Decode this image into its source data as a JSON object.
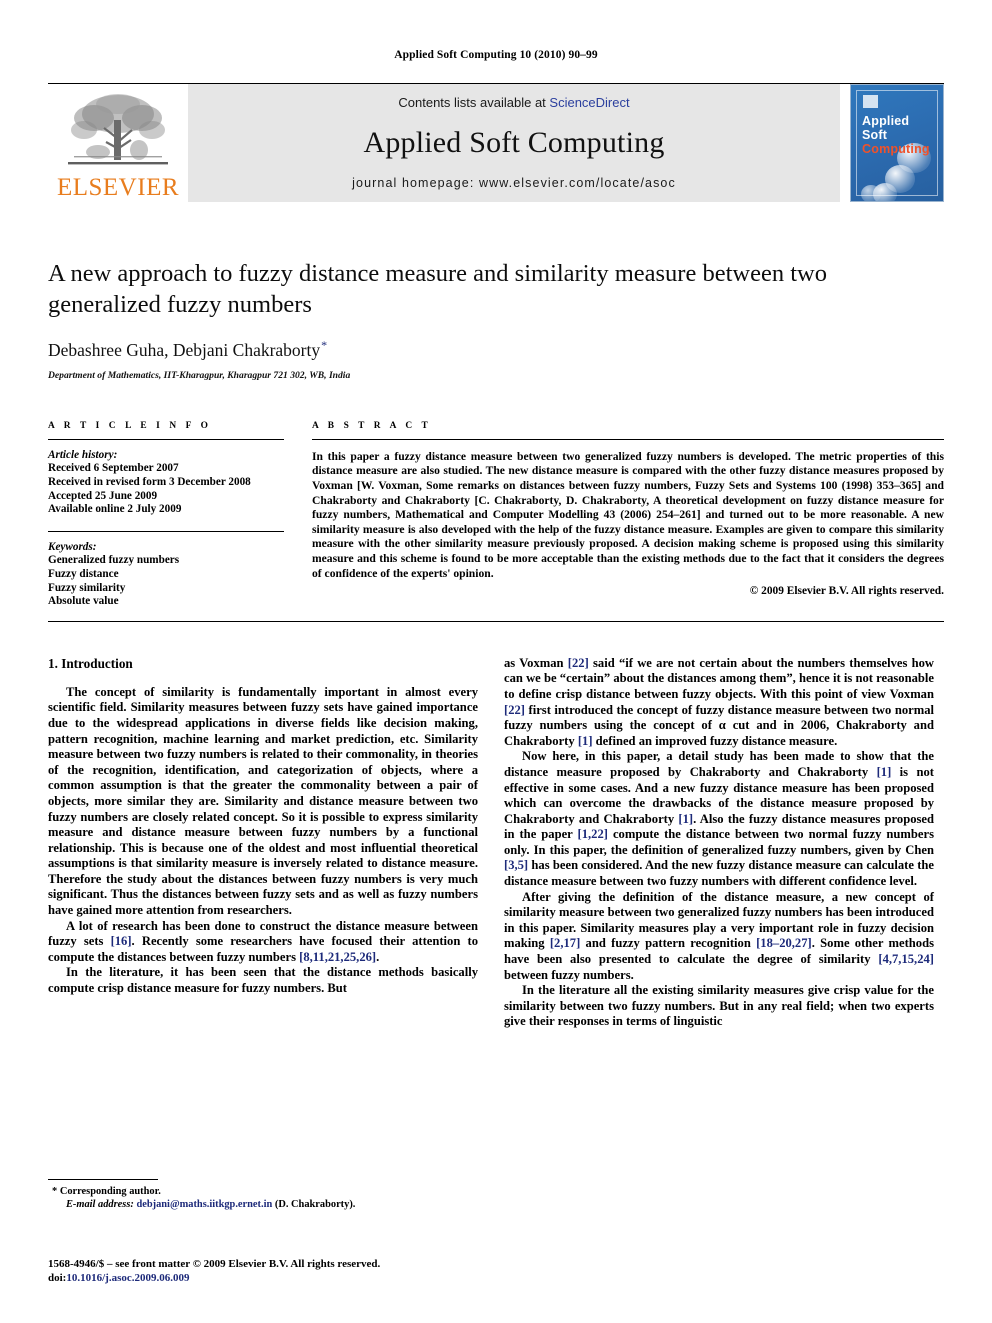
{
  "running_head": "Applied Soft Computing 10 (2010) 90–99",
  "masthead": {
    "publisher_wordmark": "ELSEVIER",
    "contents_prefix": "Contents lists available at ",
    "contents_link": "ScienceDirect",
    "journal_name": "Applied Soft Computing",
    "homepage": "journal homepage: www.elsevier.com/locate/asoc",
    "cover": {
      "line1": "Applied",
      "line2": "Soft",
      "line3": "Computing",
      "accent_color": "#f0522a",
      "background_color": "#2d6fb4"
    }
  },
  "article": {
    "title": "A new approach to fuzzy distance measure and similarity measure between two generalized fuzzy numbers",
    "authors": "Debashree Guha, Debjani Chakraborty",
    "corresponding_marker": "*",
    "affiliation": "Department of Mathematics, IIT-Kharagpur, Kharagpur 721 302, WB, India"
  },
  "article_info": {
    "heading": "A R T I C L E   I N F O",
    "history_label": "Article history:",
    "history": [
      "Received 6 September 2007",
      "Received in revised form 3 December 2008",
      "Accepted 25 June 2009",
      "Available online 2 July 2009"
    ],
    "keywords_label": "Keywords:",
    "keywords": [
      "Generalized fuzzy numbers",
      "Fuzzy distance",
      "Fuzzy similarity",
      "Absolute value"
    ]
  },
  "abstract": {
    "heading": "A B S T R A C T",
    "text": "In this paper a fuzzy distance measure between two generalized fuzzy numbers is developed. The metric properties of this distance measure are also studied. The new distance measure is compared with the other fuzzy distance measures proposed by Voxman [W. Voxman, Some remarks on distances between fuzzy numbers, Fuzzy Sets and Systems 100 (1998) 353–365] and Chakraborty and Chakraborty [C. Chakraborty, D. Chakraborty, A theoretical development on fuzzy distance measure for fuzzy numbers, Mathematical and Computer Modelling 43 (2006) 254–261] and turned out to be more reasonable. A new similarity measure is also developed with the help of the fuzzy distance measure. Examples are given to compare this similarity measure with the other similarity measure previously proposed. A decision making scheme is proposed using this similarity measure and this scheme is found to be more acceptable than the existing methods due to the fact that it considers the degrees of confidence of the experts' opinion.",
    "copyright": "© 2009 Elsevier B.V. All rights reserved."
  },
  "body": {
    "section_title": "1. Introduction",
    "left_paragraphs": [
      "The concept of similarity is fundamentally important in almost every scientific field. Similarity measures between fuzzy sets have gained importance due to the widespread applications in diverse fields like decision making, pattern recognition, machine learning and market prediction, etc. Similarity measure between two fuzzy numbers is related to their commonality, in theories of the recognition, identification, and categorization of objects, where a common assumption is that the greater the commonality between a pair of objects, more similar they are. Similarity and distance measure between two fuzzy numbers are closely related concept. So it is possible to express similarity measure and distance measure between fuzzy numbers by a functional relationship. This is because one of the oldest and most influential theoretical assumptions is that similarity measure is inversely related to distance measure. Therefore the study about the distances between fuzzy numbers is very much significant. Thus the distances between fuzzy sets and as well as fuzzy numbers have gained more attention from researchers.",
      "A lot of research has been done to construct the distance measure between fuzzy sets [16]. Recently some researchers have focused their attention to compute the distances between fuzzy numbers [8,11,21,25,26].",
      "In the literature, it has been seen that the distance methods basically compute crisp distance measure for fuzzy numbers. But"
    ],
    "right_paragraphs": [
      "as Voxman [22] said “if we are not certain about the numbers themselves how can we be “certain” about the distances among them”, hence it is not reasonable to define crisp distance between fuzzy objects. With this point of view Voxman [22] first introduced the concept of fuzzy distance measure between two normal fuzzy numbers using the concept of α cut and in 2006, Chakraborty and Chakraborty [1] defined an improved fuzzy distance measure.",
      "Now here, in this paper, a detail study has been made to show that the distance measure proposed by Chakraborty and Chakraborty [1] is not effective in some cases. And a new fuzzy distance measure has been proposed which can overcome the drawbacks of the distance measure proposed by Chakraborty and Chakraborty [1]. Also the fuzzy distance measures proposed in the paper [1,22] compute the distance between two normal fuzzy numbers only. In this paper, the definition of generalized fuzzy numbers, given by Chen [3,5] has been considered. And the new fuzzy distance measure can calculate the distance measure between two fuzzy numbers with different confidence level.",
      "After giving the definition of the distance measure, a new concept of similarity measure between two generalized fuzzy numbers has been introduced in this paper. Similarity measures play a very important role in fuzzy decision making [2,17] and fuzzy pattern recognition [18–20,27]. Some other methods have been also presented to calculate the degree of similarity [4,7,15,24] between fuzzy numbers.",
      "In the literature all the existing similarity measures give crisp value for the similarity between two fuzzy numbers. But in any real field; when two experts give their responses in terms of linguistic"
    ]
  },
  "footnote": {
    "corresponding": "Corresponding author.",
    "email_label": "E-mail address:",
    "email": "debjani@maths.iitkgp.ernet.in",
    "email_owner": "(D. Chakraborty)."
  },
  "imprint": {
    "front_matter": "1568-4946/$ – see front matter © 2009 Elsevier B.V. All rights reserved.",
    "doi_label": "doi:",
    "doi": "10.1016/j.asoc.2009.06.009"
  }
}
